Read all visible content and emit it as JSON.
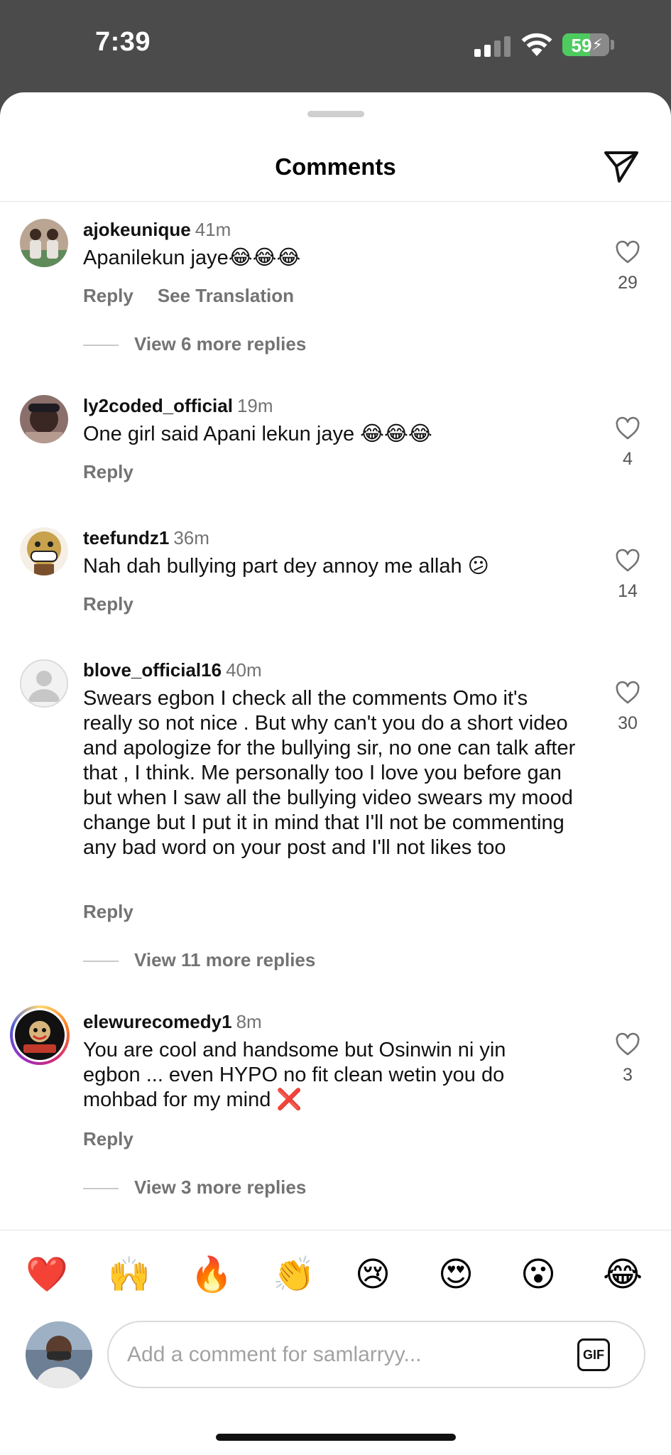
{
  "status_bar": {
    "time": "7:39",
    "battery_level": "59",
    "battery_fraction": 0.59,
    "signal_bars_active": 2,
    "signal_bars_total": 4
  },
  "sheet": {
    "title": "Comments",
    "share_icon": "paper-plane-icon"
  },
  "comments": [
    {
      "username": "ajokeunique",
      "time": "41m",
      "text": "Apanilekun jaye😂😂😂",
      "reply_label": "Reply",
      "translate_label": "See Translation",
      "likes": "29",
      "view_replies": "View 6 more replies"
    },
    {
      "username": "ly2coded_official",
      "time": "19m",
      "text": "One girl said Apani lekun jaye 😂😂😂",
      "reply_label": "Reply",
      "likes": "4"
    },
    {
      "username": "teefundz1",
      "time": "36m",
      "text": "Nah dah bullying part dey annoy me allah 😕",
      "reply_label": "Reply",
      "likes": "14"
    },
    {
      "username": "blove_official16",
      "time": "40m",
      "text": "Swears egbon I check all the comments Omo it's really so not nice . But why can't you do a short video and apologize for the bullying sir, no one can talk after that , I think. Me personally too I love you before gan but when I saw all the bullying video swears my mood change but I put it in mind that I'll not be commenting any bad word on your post and I'll not likes too",
      "reply_label": "Reply",
      "likes": "30",
      "view_replies": "View 11 more replies"
    },
    {
      "username": "elewurecomedy1",
      "time": "8m",
      "text": "You are cool and handsome but Osinwin ni yin egbon ... even HYPO no fit clean wetin you do mohbad for my mind ❌",
      "reply_label": "Reply",
      "likes": "3",
      "view_replies": "View 3 more replies"
    }
  ],
  "reactions": [
    "❤️",
    "🙌",
    "🔥",
    "👏",
    "😢",
    "😍",
    "😮",
    "😂"
  ],
  "composer": {
    "placeholder": "Add a comment for samlarryy...",
    "gif_label": "GIF"
  },
  "colors": {
    "accent_muted": "#737373",
    "story_ring": "#c13584",
    "battery_green": "#4ecb5f"
  }
}
